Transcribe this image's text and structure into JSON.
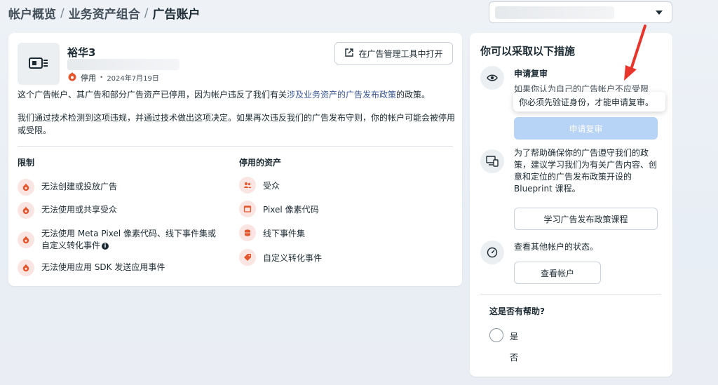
{
  "breadcrumb": {
    "item1": "帐户概览",
    "sep": "/",
    "item2": "业务资产组合",
    "item3": "广告账户"
  },
  "account": {
    "name": "裕华3",
    "status": "停用",
    "date": "2024年7月19日",
    "open_button": "在广告管理工具中打开",
    "para1_pre": "这个广告帐户、其广告和部分广告资产已停用，因为帐户违反了我们有关",
    "para1_link": "涉及业务资产的广告发布政策",
    "para1_post": "的政策。",
    "para2": "我们通过技术检测到这项违规，并通过技术做出这项决定。如果再次违反我们的广告发布守则，你的帐户可能会被停用或受限。"
  },
  "restrictions": {
    "title": "限制",
    "items": [
      {
        "label": "无法创建或投放广告"
      },
      {
        "label": "无法使用或共享受众"
      },
      {
        "label": "无法使用 Meta Pixel 像素代码、线下事件集或",
        "label2": "自定义转化事件"
      },
      {
        "label": "无法使用应用 SDK 发送应用事件"
      }
    ]
  },
  "assets": {
    "title": "停用的资产",
    "items": [
      {
        "label": "受众",
        "icon": "people-icon"
      },
      {
        "label": "Pixel 像素代码",
        "icon": "pixel-icon"
      },
      {
        "label": "线下事件集",
        "icon": "database-icon"
      },
      {
        "label": "自定义转化事件",
        "icon": "tag-icon"
      }
    ]
  },
  "actions": {
    "title": "你可以采取以下措施",
    "appeal_title": "申请复审",
    "appeal_desc": "如果你认为自己的广告帐户不应受限",
    "tooltip": "你必须先验证身份，才能申请复审。",
    "appeal_button": "申请复审",
    "learn_text": "为了帮助确保你的广告遵守我们的政策，建议学习我们为有关广告内容、创意和定位的广告发布政策开设的 Blueprint 课程。",
    "learn_button": "学习广告发布政策课程",
    "view_text": "查看其他帐户的状态。",
    "view_button": "查看帐户",
    "helpful_title": "这是否有帮助?",
    "yes": "是",
    "no": "否"
  },
  "colors": {
    "accent_disabled": "#b7d3f5",
    "error_red": "#e4572e",
    "link": "#3d5a98"
  }
}
